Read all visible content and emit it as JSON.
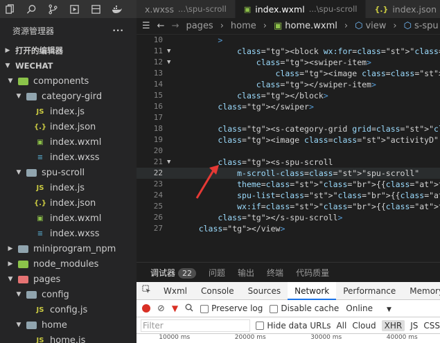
{
  "tabs": [
    {
      "name": "x.wxss",
      "path": "...\\spu-scroll",
      "icon": "wxss-icon",
      "color": "#519aba"
    },
    {
      "name": "index.wxml",
      "path": "...\\spu-scroll",
      "icon": "wxml-icon",
      "color": "#8dc149"
    },
    {
      "name": "index.json",
      "path": "...\\spu-s",
      "icon": "json-icon",
      "color": "#cbcb41"
    }
  ],
  "sidebar": {
    "title": "资源管理器",
    "more": "···",
    "open_editors": "打开的编辑器",
    "workspace": "WECHAT",
    "tree": [
      {
        "label": "components",
        "type": "folder",
        "open": true,
        "depth": 1
      },
      {
        "label": "category-gird",
        "type": "folder",
        "open": true,
        "depth": 2
      },
      {
        "label": "index.js",
        "type": "js",
        "depth": 3
      },
      {
        "label": "index.json",
        "type": "json",
        "depth": 3
      },
      {
        "label": "index.wxml",
        "type": "wxml",
        "depth": 3
      },
      {
        "label": "index.wxss",
        "type": "wxss",
        "depth": 3
      },
      {
        "label": "spu-scroll",
        "type": "folder",
        "open": true,
        "depth": 2
      },
      {
        "label": "index.js",
        "type": "js",
        "depth": 3
      },
      {
        "label": "index.json",
        "type": "json",
        "depth": 3
      },
      {
        "label": "index.wxml",
        "type": "wxml",
        "depth": 3
      },
      {
        "label": "index.wxss",
        "type": "wxss",
        "depth": 3
      },
      {
        "label": "miniprogram_npm",
        "type": "folder",
        "open": false,
        "depth": 1
      },
      {
        "label": "node_modules",
        "type": "folder",
        "open": false,
        "depth": 1
      },
      {
        "label": "pages",
        "type": "folder",
        "open": true,
        "depth": 1
      },
      {
        "label": "config",
        "type": "folder",
        "open": true,
        "depth": 2
      },
      {
        "label": "config.js",
        "type": "js",
        "depth": 3
      },
      {
        "label": "home",
        "type": "folder",
        "open": true,
        "depth": 2
      },
      {
        "label": "home.js",
        "type": "js",
        "depth": 3
      }
    ]
  },
  "breadcrumb": [
    "pages",
    "home",
    "home.wxml",
    "view",
    "s-spu"
  ],
  "code": {
    "current_line": 22,
    "lines": [
      {
        "n": "10",
        "t": "        >"
      },
      {
        "n": "11",
        "t": "            <block wx:for=\"{{bannerB.items}}\">"
      },
      {
        "n": "12",
        "t": "                <swiper-item>"
      },
      {
        "n": "13",
        "t": "                    <image class=\"swiper\" src=\"{{item.img}}\">"
      },
      {
        "n": "14",
        "t": "                </swiper-item>"
      },
      {
        "n": "15",
        "t": "            </block>"
      },
      {
        "n": "16",
        "t": "        </swiper>"
      },
      {
        "n": "17",
        "t": ""
      },
      {
        "n": "18",
        "t": "        <s-category-grid grid=\"{{grid}}\"></s-category-grid>"
      },
      {
        "n": "19",
        "t": "        <image class=\"activityD\" src=\"{{activityD.entrance_im"
      },
      {
        "n": "20",
        "t": ""
      },
      {
        "n": "21",
        "t": "        <s-spu-scroll"
      },
      {
        "n": "22",
        "t": "            m-scroll-class=\"spu-scroll\""
      },
      {
        "n": "23",
        "t": "            theme=\"{{themeE}}\""
      },
      {
        "n": "24",
        "t": "            spu-list=\"{{themeESpu}}\""
      },
      {
        "n": "25",
        "t": "            wx:if=\"{{topTheme.online}}\">"
      },
      {
        "n": "26",
        "t": "        </s-spu-scroll>"
      },
      {
        "n": "27",
        "t": "    </view>"
      }
    ]
  },
  "debugger": {
    "tabs": [
      "调试器",
      "问题",
      "输出",
      "终端",
      "代码质量"
    ],
    "badge": "22",
    "devtools_tabs": [
      "Wxml",
      "Console",
      "Sources",
      "Network",
      "Performance",
      "Memory"
    ],
    "active_devtools_tab": "Network",
    "preserve_log": "Preserve log",
    "disable_cache": "Disable cache",
    "throttle": "Online",
    "filter_placeholder": "Filter",
    "hide_data_urls": "Hide data URLs",
    "types": [
      "All",
      "Cloud",
      "XHR",
      "JS",
      "CSS"
    ],
    "timeline": [
      "10000 ms",
      "20000 ms",
      "30000 ms",
      "40000 ms"
    ]
  },
  "colors": {
    "accent": "#1a73e8",
    "arrow": "#e53935"
  }
}
